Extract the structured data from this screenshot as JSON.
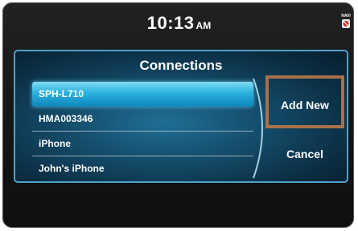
{
  "status_bar": {
    "time": "10:13",
    "ampm": "AM",
    "icon": "nav-off-icon",
    "icon_text": "NAVI"
  },
  "dialog": {
    "title": "Connections",
    "devices": [
      {
        "label": "SPH-L710",
        "selected": true
      },
      {
        "label": "HMA003346",
        "selected": false
      },
      {
        "label": "iPhone",
        "selected": false
      },
      {
        "label": "John's iPhone",
        "selected": false
      }
    ],
    "add_new_label": "Add New",
    "cancel_label": "Cancel"
  },
  "colors": {
    "popup_border": "#4ea3c8",
    "selected_row": "#2ab0dd",
    "highlight_box": "#a8714a"
  }
}
